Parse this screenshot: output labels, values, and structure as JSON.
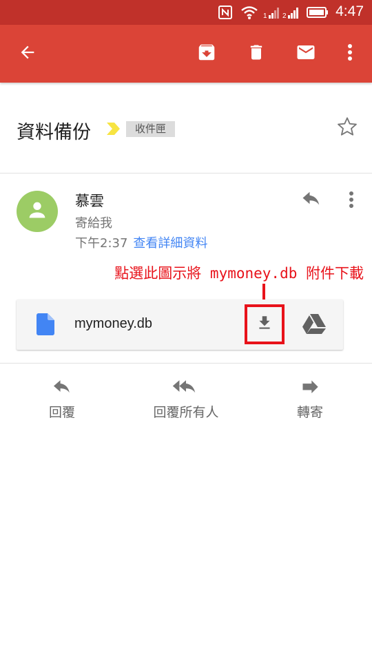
{
  "status_bar": {
    "time": "4:47",
    "icons": [
      "nfc-icon",
      "wifi-icon",
      "signal-1-icon",
      "signal-2-icon",
      "battery-icon"
    ]
  },
  "toolbar": {
    "back": "arrow-back-icon",
    "archive": "archive-icon",
    "delete": "trash-icon",
    "mark_unread": "mail-icon",
    "more": "more-vert-icon"
  },
  "email": {
    "subject": "資料備份",
    "label": "收件匣",
    "sender": "慕雲",
    "recipients": "寄給我",
    "time": "下午2:37",
    "details_link": "查看詳細資料"
  },
  "annotation": {
    "text": "點選此圖示將 mymoney.db 附件下載"
  },
  "attachment": {
    "file_name": "mymoney.db"
  },
  "actions": {
    "reply": "回覆",
    "reply_all": "回覆所有人",
    "forward": "轉寄"
  },
  "colors": {
    "status_bar": "#c0312a",
    "toolbar": "#db4437",
    "link": "#4285f4",
    "annotation": "#e8121a",
    "avatar": "#9ccc65",
    "importance": "#f7e442"
  }
}
